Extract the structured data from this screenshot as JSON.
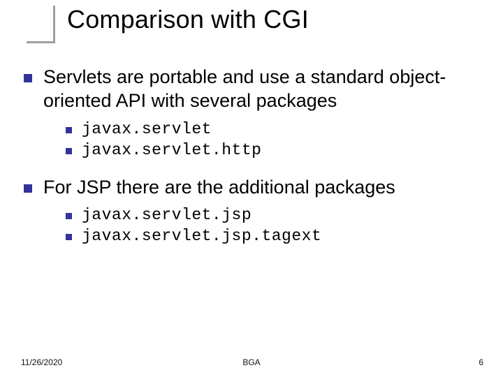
{
  "title": "Comparison with CGI",
  "bullets": [
    {
      "text": "Servlets are portable and use a standard object-oriented API with several packages",
      "sub": [
        "javax.servlet",
        "javax.servlet.http"
      ]
    },
    {
      "text": "For JSP there are the additional packages",
      "sub": [
        "javax.servlet.jsp",
        "javax.servlet.jsp.tagext"
      ]
    }
  ],
  "footer": {
    "date": "11/26/2020",
    "center": "BGA",
    "page": "6"
  },
  "colors": {
    "bullet": "#333399",
    "frame": "#9ea0a3"
  }
}
